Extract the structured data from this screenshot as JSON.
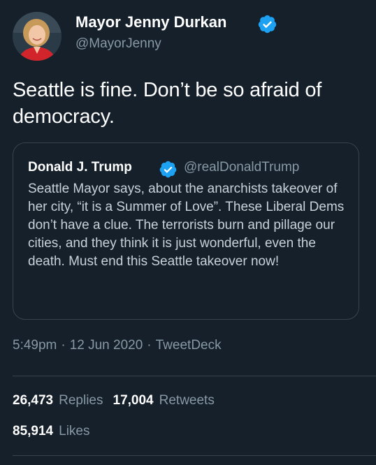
{
  "tweet": {
    "author_name": "Mayor Jenny Durkan",
    "author_handle": "@MayorJenny",
    "text": "Seattle is fine. Don’t be so afraid of democracy."
  },
  "quoted_tweet": {
    "author_name": "Donald J. Trump",
    "author_handle": "@realDonaldTrump",
    "text": "Seattle Mayor says, about the anarchists takeover of her city, “it is a Summer of Love”. These Liberal Dems don’t have a clue. The terrorists burn and pillage our cities, and they think it is just wonderful, even the death. Must end this Seattle takeover now!"
  },
  "meta": {
    "time": "5:49pm",
    "date": "12 Jun 2020",
    "source": "TweetDeck",
    "separator": "·"
  },
  "stats": {
    "replies_count": "26,473",
    "replies_label": "Replies",
    "retweets_count": "17,004",
    "retweets_label": "Retweets",
    "likes_count": "85,914",
    "likes_label": "Likes"
  },
  "icons": {
    "verified": "verified-badge-icon"
  },
  "colors": {
    "background": "#15202b",
    "accent": "#1da1f2",
    "secondary_text": "#8899a6",
    "border": "#38444d"
  }
}
